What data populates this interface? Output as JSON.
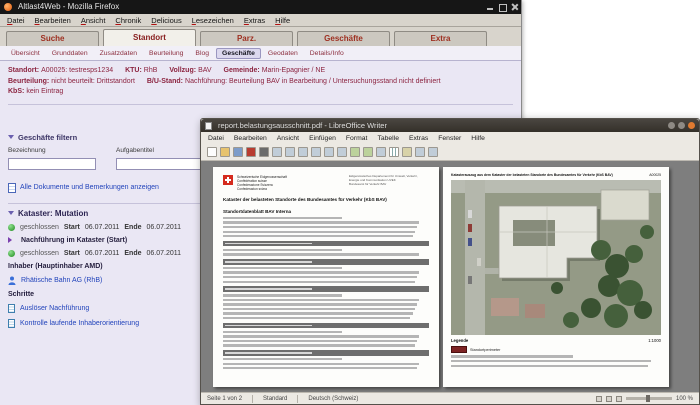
{
  "firefox": {
    "titlebar": {
      "title": "Altlast4Web - Mozilla Firefox"
    },
    "menu": [
      "Datei",
      "Bearbeiten",
      "Ansicht",
      "Chronik",
      "Delicious",
      "Lesezeichen",
      "Extras",
      "Hilfe"
    ],
    "tabs": [
      "Suche",
      "Standort",
      "Parz.",
      "Geschäfte",
      "Extra"
    ],
    "subtabs": [
      "Übersicht",
      "Grunddaten",
      "Zusatzdaten",
      "Beurteilung",
      "Blog",
      "Geschäfte",
      "Geodaten",
      "Details/Info"
    ],
    "header": {
      "l1": [
        {
          "k": "Standort:",
          "v": "A00025: testresps1234"
        },
        {
          "k": "KTU:",
          "v": "RhB"
        },
        {
          "k": "Vollzug:",
          "v": "BAV"
        },
        {
          "k": "Gemeinde:",
          "v": "Marin-Epagnier / NE"
        }
      ],
      "l2": [
        {
          "k": "Beurteilung:",
          "v": "nicht beurteilt: Drittstandort"
        },
        {
          "k": "B/U-Stand:",
          "v": "Nachführung: Beurteilung BAV in Bearbeitung / Untersuchungsstand nicht definiert"
        }
      ],
      "l3": [
        {
          "k": "KbS:",
          "v": "kein Eintrag"
        }
      ]
    },
    "filter": {
      "title": "Geschäfte filtern",
      "field1_label": "Bezeichnung",
      "field2_label": "Aufgabentitel"
    },
    "link_all_docs": "Alle Dokumente und Bemerkungen anzeigen",
    "kataster": {
      "title": "Kataster: Mutation",
      "row1": {
        "state": "geschlossen",
        "start_k": "Start",
        "start_v": "06.07.2011",
        "end_k": "Ende",
        "end_v": "06.07.2011"
      },
      "item1": "Nachführung im Kataster (Start)",
      "row2": {
        "state": "geschlossen",
        "start_k": "Start",
        "start_v": "06.07.2011",
        "end_k": "Ende",
        "end_v": "06.07.2011"
      },
      "owner_label": "Inhaber (Hauptinhaber AMD)",
      "owner_name": "Rhätische Bahn AG (RhB)",
      "steps_label": "Schritte",
      "step1": "Auslöser Nachführung",
      "step2": "Kontrolle laufende Inhaberorientierung"
    }
  },
  "writer": {
    "titlebar": {
      "title": "report.belastungsausschnitt.pdf - LibreOffice Writer"
    },
    "menu": [
      "Datei",
      "Bearbeiten",
      "Ansicht",
      "Einfügen",
      "Format",
      "Tabelle",
      "Extras",
      "Fenster",
      "Hilfe"
    ],
    "toolbar_icons": [
      "new-doc",
      "open",
      "save",
      "export-pdf",
      "print",
      "print-preview",
      "spellcheck",
      "cut",
      "copy",
      "paste",
      "clone-format",
      "undo",
      "redo",
      "hyperlink",
      "table",
      "find",
      "navigator",
      "zoom"
    ],
    "page_left": {
      "confed": [
        "Schweizerische Eidgenossenschaft",
        "Confédération suisse",
        "Confederazione Svizzera",
        "Confederaziun svizra"
      ],
      "dept": [
        "Eidgenössisches Departement für Umwelt, Verkehr,",
        "Energie und Kommunikation UVEK",
        "Bundesamt für Verkehr BAV"
      ],
      "title_line1": "Kataster der belasteten Standorte des Bundesamtes für Verkehr (KbS BAV)",
      "title_line2": "Standortdatenblatt BAV Interna"
    },
    "page_right": {
      "title": "Katasterauszug aus dem Kataster der belasteten Standorte des Bundesamtes für Verkehr (KbS BAV)",
      "ref": "A00025",
      "legend_label": "Legende",
      "scale": "1:1000",
      "legend_item": "Standortperimeter"
    },
    "statusbar": {
      "page": "Seite 1 von 2",
      "style": "Standard",
      "lang": "Deutsch (Schweiz)",
      "zoom": "100 %"
    }
  }
}
